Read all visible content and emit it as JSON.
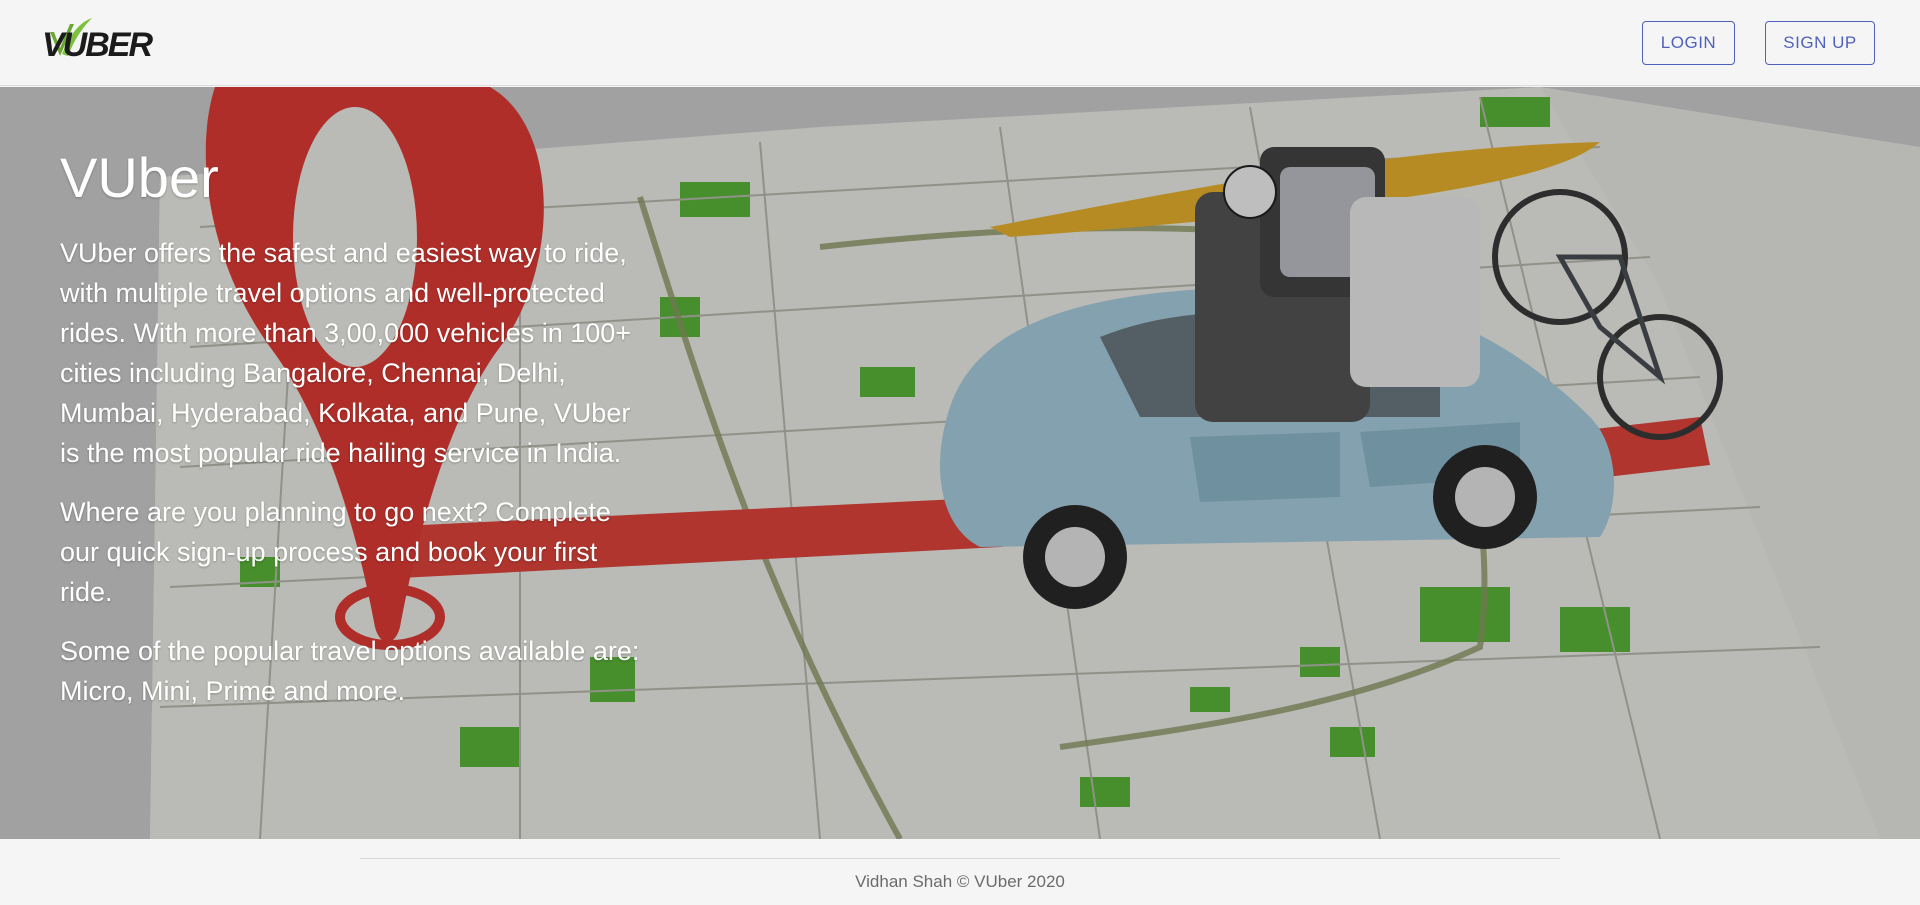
{
  "header": {
    "logo_text": "VUBER",
    "login_label": "LOGIN",
    "signup_label": "SIGN UP",
    "accent_color": "#3f51b5"
  },
  "hero": {
    "title": "VUber",
    "paragraphs": [
      "VUber offers the safest and easiest way to ride, with multiple travel options and well-protected rides. With more than 3,00,000 vehicles in 100+ cities including Bangalore, Chennai, Delhi, Mumbai, Hyderabad, Kolkata, and Pune, VUber is the most popular ride hailing service in India.",
      "Where are you planning to go next? Complete our quick sign-up process and book your first ride.",
      "Some of the popular travel options available are: Micro, Mini, Prime and more."
    ],
    "background_image": "map-with-car-and-location-pin"
  },
  "footer": {
    "copyright": "Vidhan Shah © VUber 2020"
  }
}
